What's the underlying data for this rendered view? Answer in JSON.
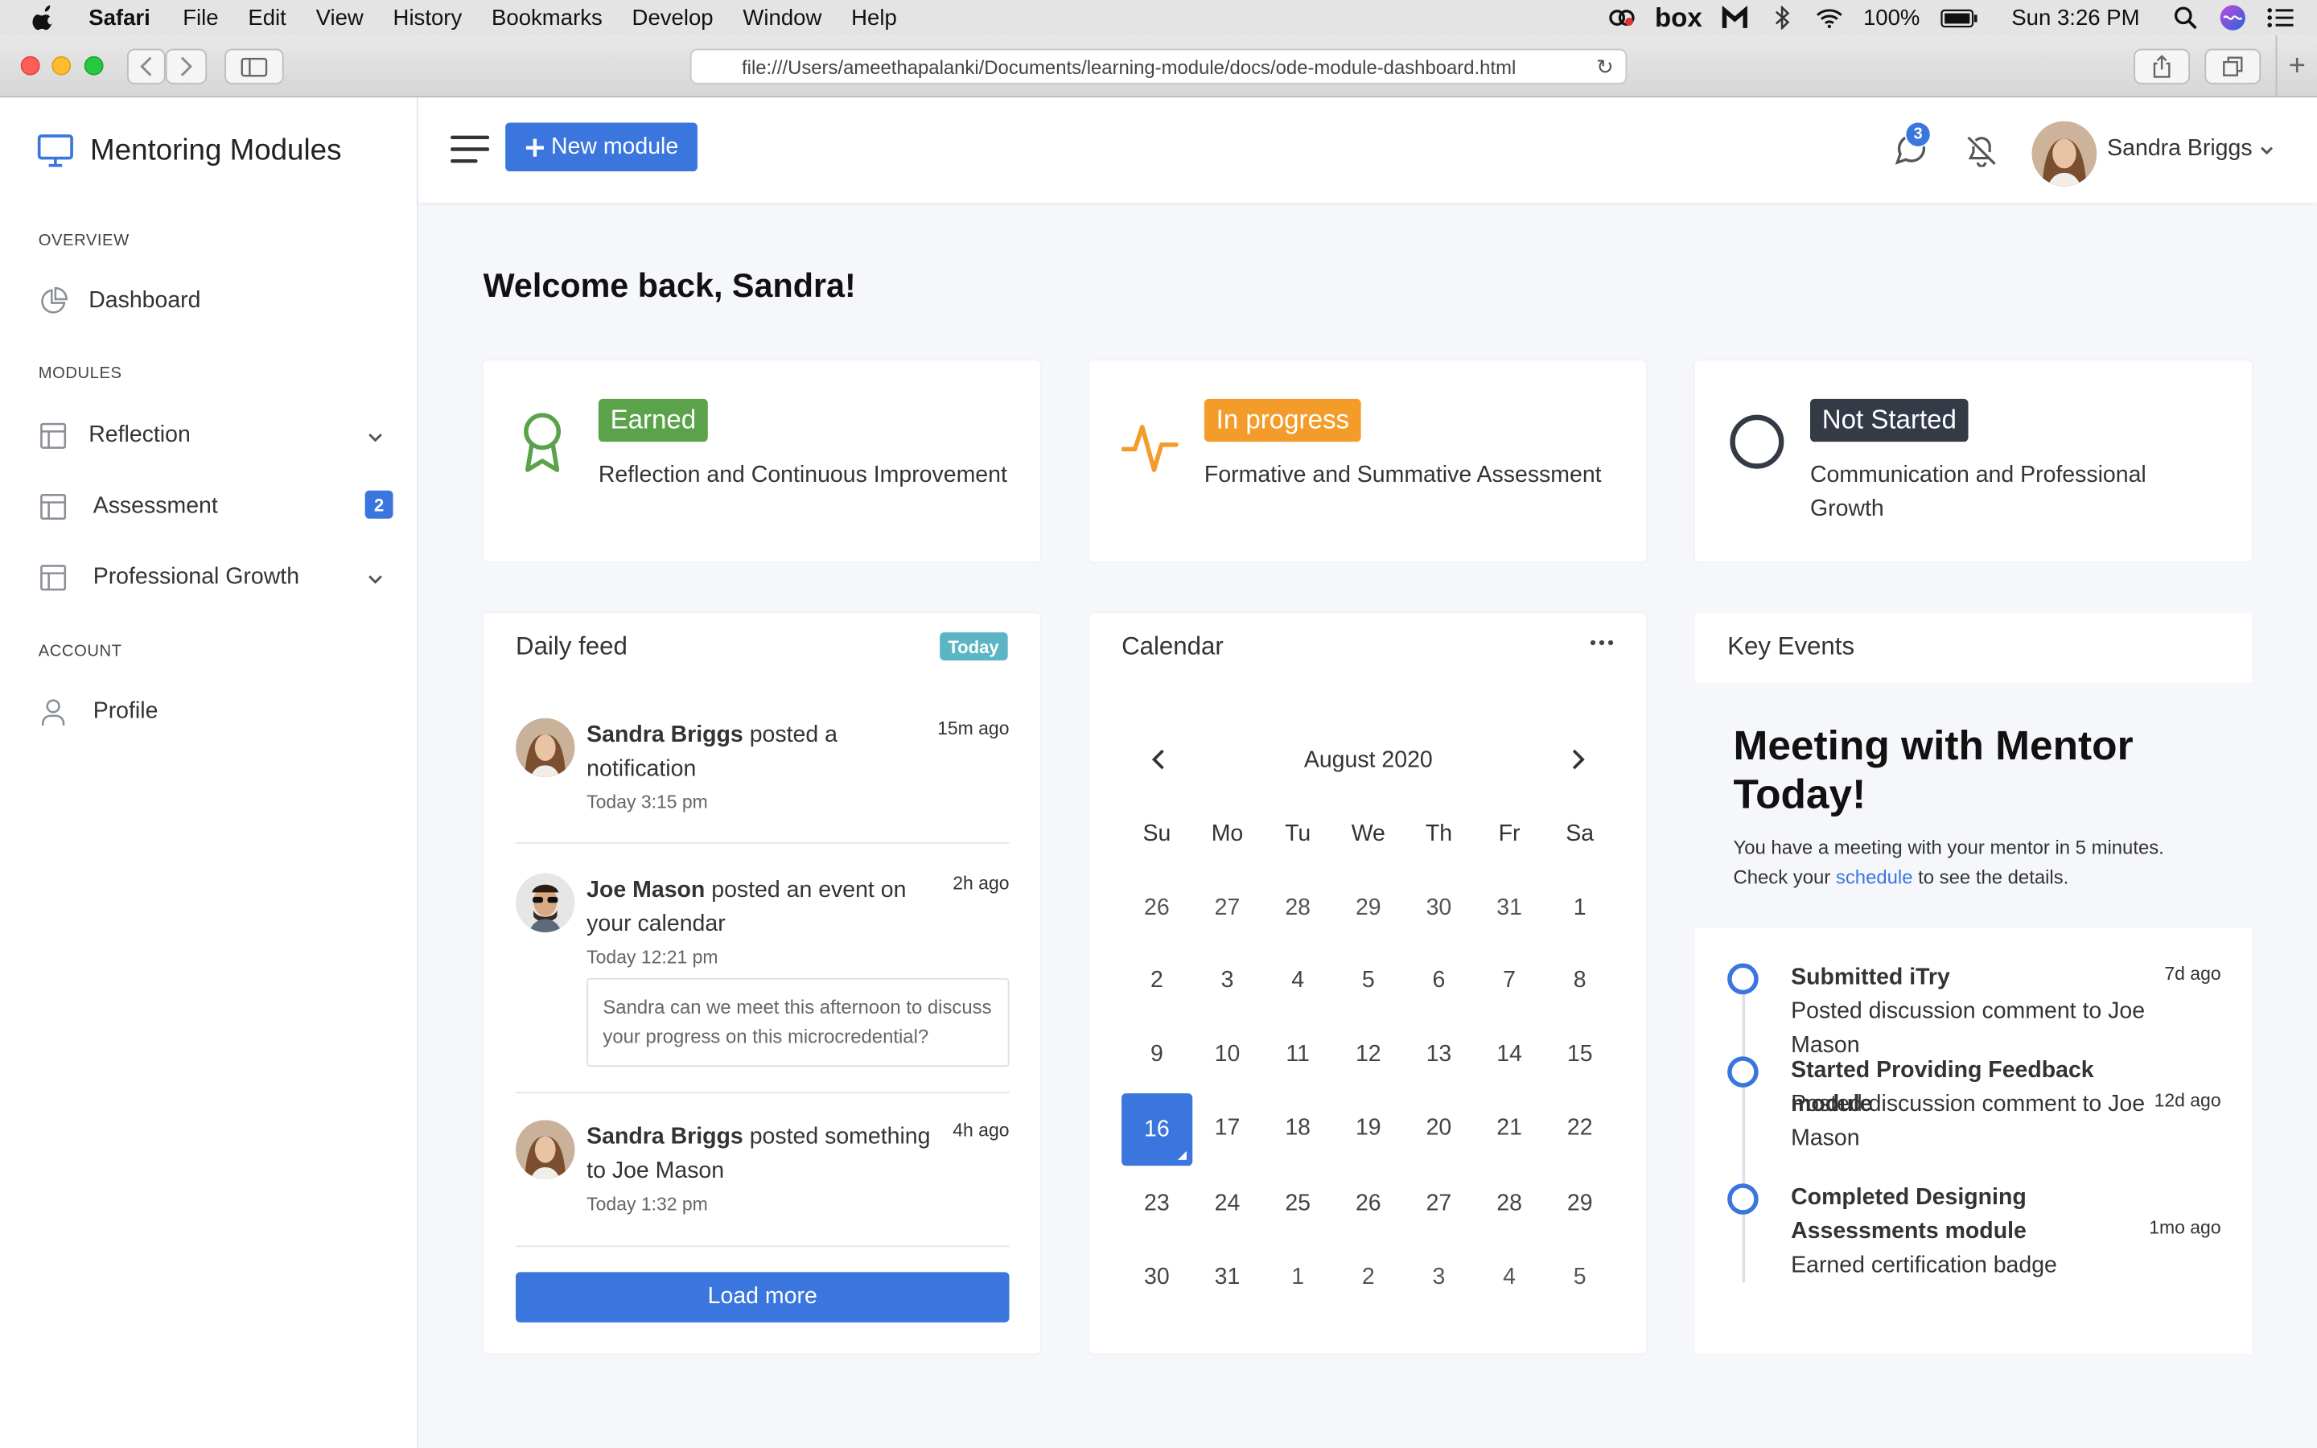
{
  "menubar": {
    "app": "Safari",
    "items": [
      "File",
      "Edit",
      "View",
      "History",
      "Bookmarks",
      "Develop",
      "Window",
      "Help"
    ],
    "battery": "100%",
    "clock": "Sun 3:26 PM",
    "box_label": "box"
  },
  "browser": {
    "url": "file:///Users/ameethapalanki/Documents/learning-module/docs/ode-module-dashboard.html"
  },
  "sidebar": {
    "brand": "Mentoring Modules",
    "sections": {
      "overview": "OVERVIEW",
      "modules": "MODULES",
      "account": "ACCOUNT"
    },
    "items": {
      "dashboard": "Dashboard",
      "reflection": "Reflection",
      "assessment": "Assessment",
      "assessment_badge": "2",
      "growth": "Professional Growth",
      "profile": "Profile"
    }
  },
  "header": {
    "new_module": "New module",
    "chat_count": "3",
    "user_name": "Sandra Briggs"
  },
  "welcome": "Welcome back, Sandra!",
  "status_cards": [
    {
      "tag": "Earned",
      "desc": "Reflection and Continuous Improvement",
      "color": "#5aa34b"
    },
    {
      "tag": "In progress",
      "desc": "Formative and Summative Assessment",
      "color": "#f39c2a"
    },
    {
      "tag": "Not Started",
      "desc": "Communication and Professional Growth",
      "color": "#343a46"
    }
  ],
  "feed": {
    "title": "Daily feed",
    "tag": "Today",
    "items": [
      {
        "name": "Sandra Briggs",
        "action": " posted a notification",
        "ago": "15m ago",
        "time": "Today 3:15 pm"
      },
      {
        "name": "Joe Mason",
        "action": " posted an event on your calendar",
        "ago": "2h ago",
        "time": "Today 12:21 pm",
        "quote": "Sandra can we meet this afternoon to discuss your progress on this microcredential?"
      },
      {
        "name": "Sandra Briggs",
        "action": " posted something to Joe Mason",
        "ago": "4h ago",
        "time": "Today 1:32 pm"
      }
    ],
    "load_more": "Load more"
  },
  "calendar": {
    "title": "Calendar",
    "month": "August 2020",
    "weekdays": [
      "Su",
      "Mo",
      "Tu",
      "We",
      "Th",
      "Fr",
      "Sa"
    ],
    "weeks": [
      [
        "26",
        "27",
        "28",
        "29",
        "30",
        "31",
        "1"
      ],
      [
        "2",
        "3",
        "4",
        "5",
        "6",
        "7",
        "8"
      ],
      [
        "9",
        "10",
        "11",
        "12",
        "13",
        "14",
        "15"
      ],
      [
        "16",
        "17",
        "18",
        "19",
        "20",
        "21",
        "22"
      ],
      [
        "23",
        "24",
        "25",
        "26",
        "27",
        "28",
        "29"
      ],
      [
        "30",
        "31",
        "1",
        "2",
        "3",
        "4",
        "5"
      ]
    ],
    "selected": "16"
  },
  "key_events": {
    "title": "Key Events",
    "banner_title": "Meeting with Mentor Today!",
    "banner_text_1": "You have a meeting with your mentor in 5 minutes.",
    "banner_text_2": "Check your ",
    "banner_link": "schedule",
    "banner_text_3": " to see the details.",
    "items": [
      {
        "title": "Submitted iTry",
        "sub": "Posted discussion comment to Joe Mason",
        "ago": "7d ago"
      },
      {
        "title": "Started Providing Feedback module",
        "sub": "Posted discussion comment to Joe Mason",
        "ago": "12d ago"
      },
      {
        "title": "Completed Designing Assessments module",
        "sub": "Earned certification badge",
        "ago": "1mo ago"
      }
    ]
  }
}
